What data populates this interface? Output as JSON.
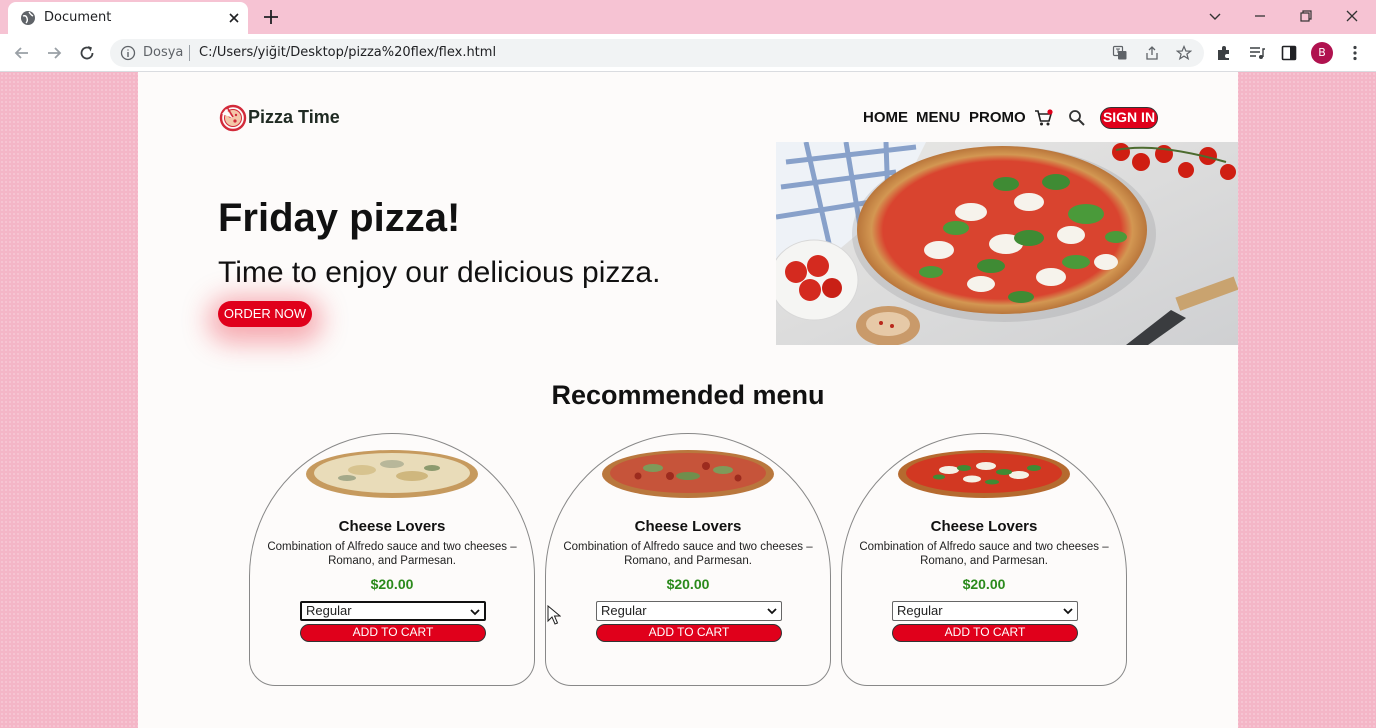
{
  "browser": {
    "tab_title": "Document",
    "address_prefix": "Dosya",
    "url": "C:/Users/yiğit/Desktop/pizza%20flex/flex.html",
    "profile_initial": "B"
  },
  "site": {
    "brand": "Pizza Time",
    "nav": {
      "home": "HOME",
      "menu": "MENU",
      "promo": "PROMO",
      "sign_in": "SIGN IN"
    },
    "hero": {
      "title": "Friday pizza!",
      "subtitle": "Time to enjoy our delicious pizza.",
      "cta": "ORDER NOW"
    },
    "recommended_title": "Recommended menu",
    "cards": [
      {
        "name": "Cheese Lovers",
        "description": "Combination of Alfredo sauce and two cheeses – Romano, and Parmesan.",
        "price": "$20.00",
        "size": "Regular",
        "button": "ADD TO CART"
      },
      {
        "name": "Cheese Lovers",
        "description": "Combination of Alfredo sauce and two cheeses – Romano, and Parmesan.",
        "price": "$20.00",
        "size": "Regular",
        "button": "ADD TO CART"
      },
      {
        "name": "Cheese Lovers",
        "description": "Combination of Alfredo sauce and two cheeses – Romano, and Parmesan.",
        "price": "$20.00",
        "size": "Regular",
        "button": "ADD TO CART"
      }
    ]
  },
  "colors": {
    "accent": "#e0001b",
    "price": "#2b8a1c",
    "page_background": "#f4b6c7"
  }
}
